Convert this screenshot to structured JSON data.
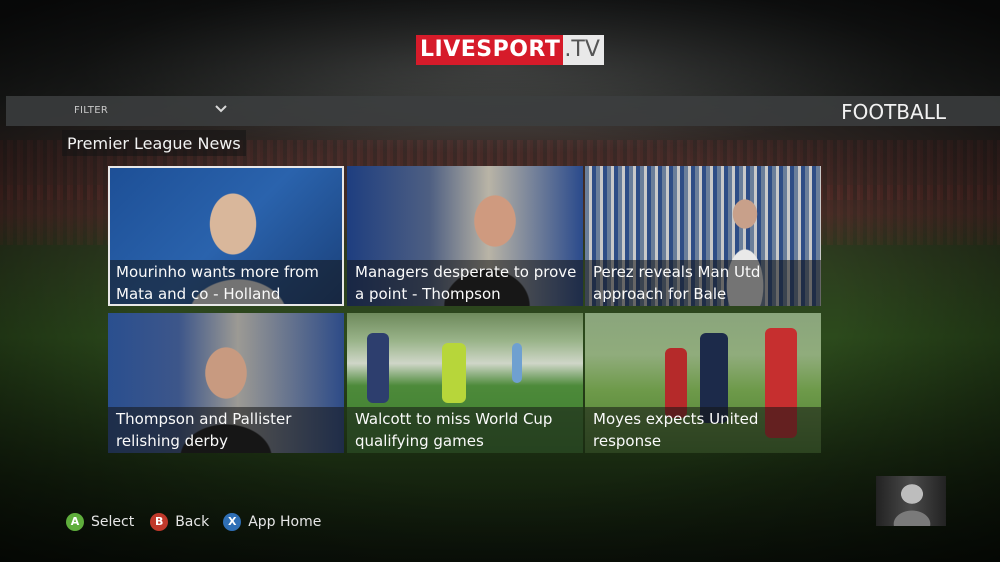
{
  "logo": {
    "part1": "LIVESPORT",
    "part2": ".TV"
  },
  "filter": {
    "label": "FILTER",
    "value": "FOOTBALL"
  },
  "section_title": "Premier League News",
  "tiles": [
    {
      "title": "Mourinho wants more from Mata and co - Holland",
      "selected": true
    },
    {
      "title": "Managers desperate to prove a point - Thompson"
    },
    {
      "title": "Perez reveals Man Utd approach for Bale"
    },
    {
      "title": "Thompson and Pallister relishing derby"
    },
    {
      "title": "Walcott to miss World Cup qualifying games"
    },
    {
      "title": "Moyes expects United response"
    }
  ],
  "controls": [
    {
      "key": "A",
      "label": "Select",
      "color": "#5fae3c"
    },
    {
      "key": "B",
      "label": "Back",
      "color": "#c0392b"
    },
    {
      "key": "X",
      "label": "App Home",
      "color": "#2f6fb6"
    }
  ],
  "colors": {
    "brand_red": "#d61b2a",
    "accent_bar": "#3c3e40"
  }
}
